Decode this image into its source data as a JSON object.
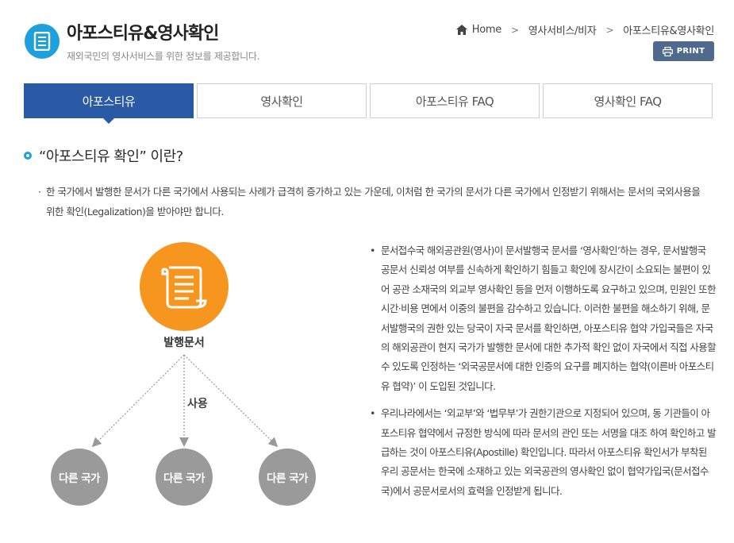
{
  "header": {
    "title": "아포스티유&영사확인",
    "subtitle": "재외국민의 영사서비스를 위한 정보를 제공합니다.",
    "icon": "document-list-icon"
  },
  "breadcrumb": {
    "home": "Home",
    "level1": "영사서비스/비자",
    "current": "아포스티유&영사확인",
    "separator": ">"
  },
  "print_button": {
    "label": "PRINT",
    "icon": "printer-icon"
  },
  "tabs": [
    {
      "label": "아포스티유",
      "active": true
    },
    {
      "label": "영사확인",
      "active": false
    },
    {
      "label": "아포스티유 FAQ",
      "active": false
    },
    {
      "label": "영사확인 FAQ",
      "active": false
    }
  ],
  "section": {
    "title": "“아포스티유 확인” 이란?",
    "intro_bullet": "·",
    "intro": "한 국가에서 발행한 문서가 다른 국가에서 사용되는 사례가 급격히 증가하고 있는 가운데, 이처럼 한 국가의 문서가 다른 국가에서 인정받기 위해서는 문서의 국외사용을 위한 확인(Legalization)을 받아야만 합니다."
  },
  "diagram": {
    "source_label": "발행문서",
    "use_label": "사용",
    "targets": [
      "다른 국가",
      "다른 국가",
      "다른 국가"
    ],
    "colors": {
      "source": "#f7961e",
      "target": "#9a9a9a"
    }
  },
  "details": {
    "bullet": "•",
    "paragraphs": [
      "문서접수국 해외공관원(영사)이 문서발행국 문서를 ‘영사확인’하는 경우, 문서발행국 공문서 신뢰성 여부를 신속하게 확인하기 힘들고 확인에 장시간이 소요되는 불편이 있어 공관 소재국의 외교부 영사확인 등을 먼저 이행하도록 요구하고 있으며, 민원인 또한 시간·비용 면에서 이중의 불편을 감수하고 있습니다. 이러한 불편을 해소하기 위해, 문서발행국의 권한 있는 당국이 자국 문서를 확인하면, 아포스티유 협약 가입국들은 자국의 해외공관이 현지 국가가 발행한 문서에 대한 추가적 확인 없이 자국에서 직접 사용할 수 있도록 인정하는 ‘외국공문서에 대한 인증의 요구를 폐지하는 협약(이른바 아포스티유 협약)’ 이 도입된 것입니다.",
      "우리나라에서는 ‘외교부’와 ‘법무부’가 권한기관으로 지정되어 있으며, 동 기관들이 아포스티유 협약에서 규정한 방식에 따라 문서의 관인 또는 서명을 대조 하여 확인하고 발급하는 것이 아포스티유(Apostille) 확인입니다. 따라서 아포스티유 확인서가 부착된 우리 공문서는 한국에 소재하고 있는 외국공관의 영사확인 없이 협약가입국(문서접수국)에서 공문서로서의 효력을 인정받게 됩니다."
    ]
  },
  "colors": {
    "accent": "#1ea0dc",
    "tab_active": "#2a5aa5",
    "print_bg": "#4f6a8c"
  }
}
